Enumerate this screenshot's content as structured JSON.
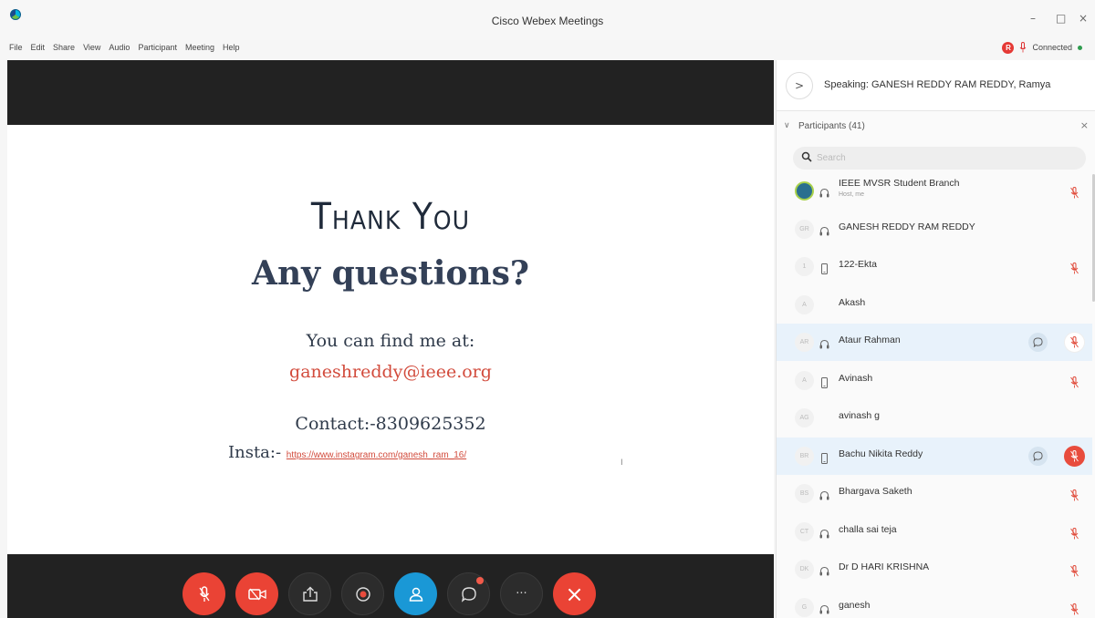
{
  "window": {
    "title": "Cisco Webex Meetings",
    "min": "–",
    "max": "□",
    "close": "×"
  },
  "menu": [
    "File",
    "Edit",
    "Share",
    "View",
    "Audio",
    "Participant",
    "Meeting",
    "Help"
  ],
  "status": {
    "recording_badge": "R",
    "connection": "Connected"
  },
  "slide": {
    "title": "Thank You",
    "subtitle": "Any questions?",
    "find_text": "You can find me at:",
    "email": "ganeshreddy@ieee.org",
    "contact": "Contact:-8309625352",
    "insta_label": "Insta:-",
    "insta_link": "https://www.instagram.com/ganesh_ram_16/",
    "cursor_mark": "I"
  },
  "controls": {
    "mute": "mute-icon",
    "video": "video-off-icon",
    "share": "share-icon",
    "record": "record-icon",
    "participants": "participants-icon",
    "chat": "chat-icon",
    "more": "···",
    "end": "×"
  },
  "panel": {
    "speaking_toggle": ">",
    "speaking": "Speaking: GANESH REDDY RAM REDDY, Ramya",
    "participants_title": "Participants (41)",
    "participants_chevron": "∨",
    "close": "×",
    "search_placeholder": "Search"
  },
  "participants": [
    {
      "initials": "",
      "name": "IEEE MVSR Student Branch",
      "sub": "Host, me",
      "host": true,
      "device": "headset",
      "mic": true,
      "highlight": false
    },
    {
      "initials": "GR",
      "name": "GANESH REDDY RAM REDDY",
      "sub": "",
      "device": "headset",
      "mic": false,
      "highlight": false
    },
    {
      "initials": "1",
      "name": "122-Ekta",
      "sub": "",
      "device": "phone",
      "mic": true,
      "highlight": false
    },
    {
      "initials": "A",
      "name": "Akash",
      "sub": "",
      "device": "",
      "mic": false,
      "highlight": false
    },
    {
      "initials": "AR",
      "name": "Ataur Rahman",
      "sub": "",
      "device": "headset",
      "mic": true,
      "highlight": true,
      "chat": true
    },
    {
      "initials": "A",
      "name": "Avinash",
      "sub": "",
      "device": "phone",
      "mic": true,
      "highlight": false
    },
    {
      "initials": "AG",
      "name": "avinash g",
      "sub": "",
      "device": "",
      "mic": false,
      "highlight": false
    },
    {
      "initials": "BR",
      "name": "Bachu Nikita Reddy",
      "sub": "",
      "device": "phone",
      "mic": true,
      "highlight": true,
      "chat": true,
      "mic_active": true
    },
    {
      "initials": "BS",
      "name": "Bhargava Saketh",
      "sub": "",
      "device": "headset",
      "mic": true,
      "highlight": false
    },
    {
      "initials": "CT",
      "name": "challa sai teja",
      "sub": "",
      "device": "headset",
      "mic": true,
      "highlight": false
    },
    {
      "initials": "DK",
      "name": "Dr D HARI KRISHNA",
      "sub": "",
      "device": "headset",
      "mic": true,
      "highlight": false
    },
    {
      "initials": "G",
      "name": "ganesh",
      "sub": "",
      "device": "headset",
      "mic": true,
      "highlight": false
    }
  ],
  "colors": {
    "accent": "#1a98d6",
    "danger": "#ea4335",
    "email": "#d24b3c",
    "stage": "#222222"
  }
}
